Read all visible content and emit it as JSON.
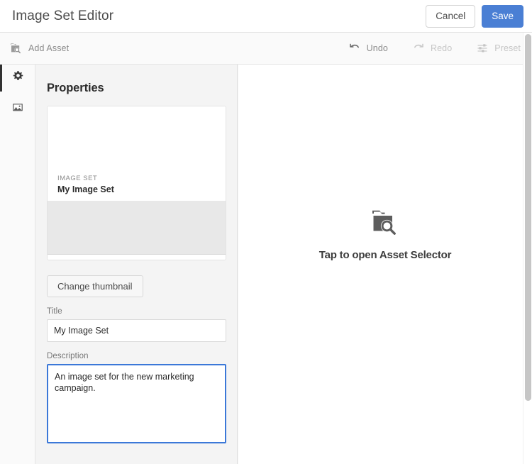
{
  "header": {
    "title": "Image Set Editor",
    "cancel_label": "Cancel",
    "save_label": "Save"
  },
  "toolbar": {
    "add_asset_label": "Add Asset",
    "add_asset_icon": "asset-search-icon",
    "undo_label": "Undo",
    "undo_icon": "undo-arrow-icon",
    "redo_label": "Redo",
    "redo_icon": "redo-arrow-icon",
    "preset_label": "Preset",
    "preset_icon": "sliders-icon"
  },
  "rail": {
    "items": [
      {
        "name": "properties",
        "icon": "gear-icon",
        "active": true
      },
      {
        "name": "assets",
        "icon": "image-icon",
        "active": false
      }
    ]
  },
  "properties": {
    "title": "Properties",
    "thumbnail_card": {
      "kicker": "IMAGE SET",
      "name": "My Image Set"
    },
    "change_thumbnail_label": "Change thumbnail",
    "fields": [
      {
        "label": "Title",
        "value": "My Image Set",
        "placeholder": "Title"
      },
      {
        "label": "Description",
        "value": "An image set for the new marketing campaign.",
        "placeholder": "Description"
      }
    ]
  },
  "canvas": {
    "drop_label": "Tap to open Asset Selector",
    "drop_icon": "folder-search-icon"
  },
  "colors": {
    "accent": "#4a7fd4",
    "focus_border": "#3b78d8",
    "panel_bg": "#f4f4f4",
    "toolbar_bg": "#fafafa",
    "text_primary": "#2b2b2b",
    "text_muted": "#8c8c8c",
    "text_disabled": "#c6c6c6"
  }
}
